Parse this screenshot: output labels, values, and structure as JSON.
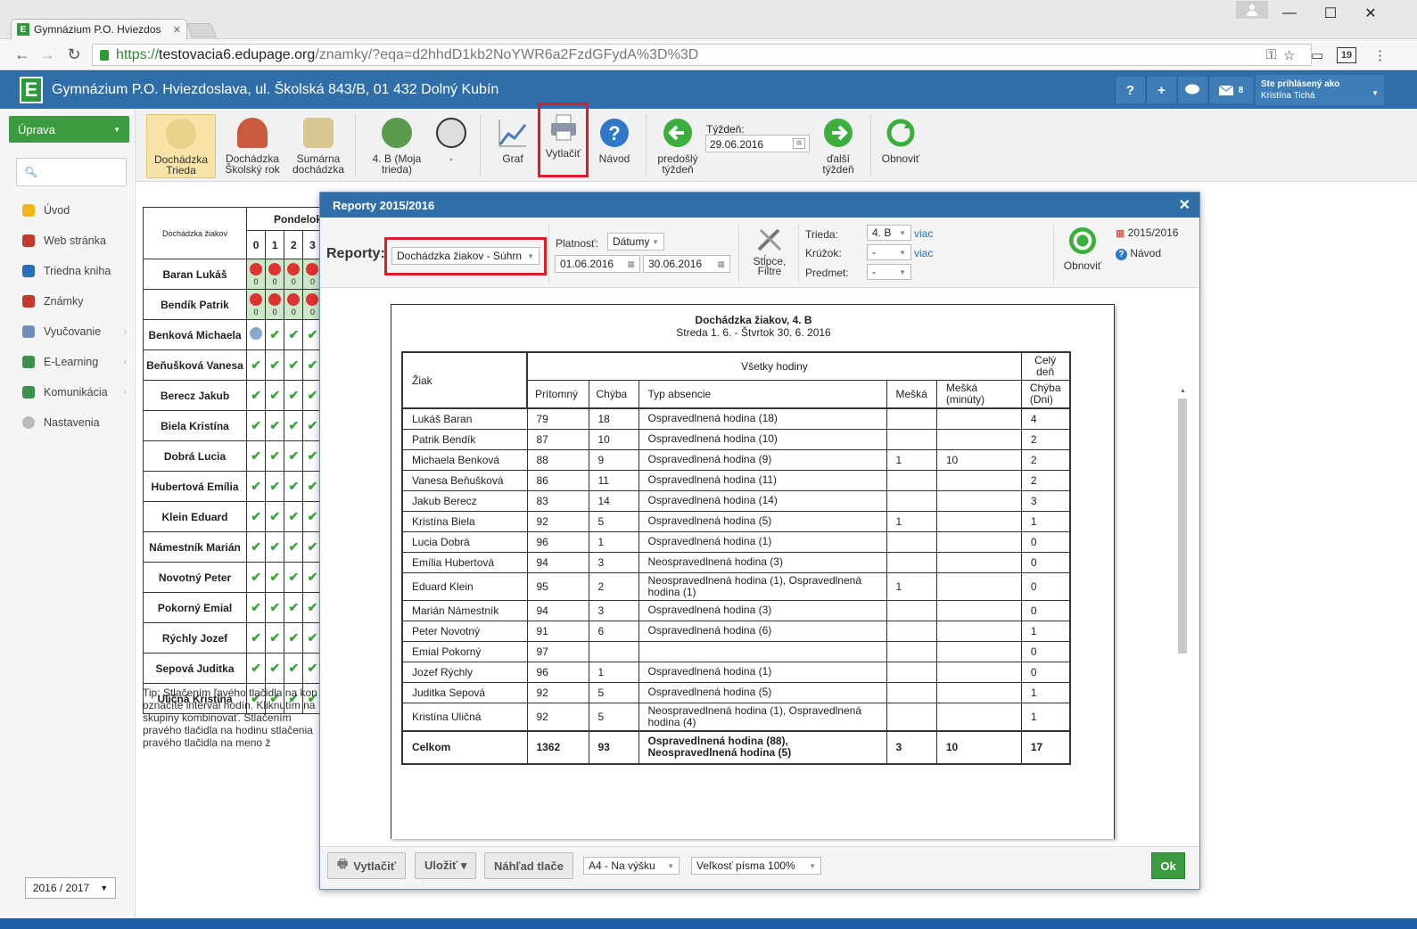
{
  "browser": {
    "tab_title": "Gymnázium P.O. Hviezdos",
    "url_scheme": "https://",
    "url_host": "testovacia6.edupage.org",
    "url_path": "/znamky/?eqa=d2hhdD1kb2NoYWR6a2FzdGFydA%3D%3D",
    "calendar_badge": "19"
  },
  "header": {
    "school_name": "Gymnázium P.O. Hviezdoslava, ul. Školská 843/B, 01 432 Dolný Kubín",
    "help": "?",
    "add": "+",
    "messages_count": "8",
    "logged_label": "Ste prihlásený ako",
    "user_name": "Kristína Tichá"
  },
  "sidebar": {
    "edit_button": "Úprava",
    "items": [
      "Úvod",
      "Web stránka",
      "Triedna kniha",
      "Známky",
      "Vyučovanie",
      "E-Learning",
      "Komunikácia",
      "Nastavenia"
    ],
    "year": "2016 / 2017"
  },
  "toolbar": {
    "btn1": "Dochádzka Trieda",
    "btn2": "Dochádzka Školský rok",
    "btn3": "Sumárna dochádzka",
    "btn4": "4. B (Moja trieda)",
    "btn5": "-",
    "btn6": "Graf",
    "btn7": "Vytlačiť",
    "btn8": "Návod",
    "btn9": "predošlý týždeň",
    "week_label": "Týždeň:",
    "week_value": "29.06.2016",
    "btn10": "ďalší týždeň",
    "btn11": "Obnoviť"
  },
  "attendance": {
    "header": "Dochádzka žiakov",
    "day": "Pondelok",
    "hours": [
      "0",
      "1",
      "2",
      "3"
    ],
    "zero": "0",
    "students": [
      "Baran Lukáš",
      "Bendík Patrik",
      "Benková Michaela",
      "Beňušková Vanesa",
      "Berecz Jakub",
      "Biela Kristína",
      "Dobrá Lucia",
      "Hubertová Emília",
      "Klein Eduard",
      "Námestník Marián",
      "Novotný Peter",
      "Pokorný Emial",
      "Rýchly Jozef",
      "Sepová Juditka",
      "Uličná Kristína"
    ],
    "tip": "Tip: Stlačením ľavého tlačidla na kon označíte interval hodín. Kliknutím na skupiny kombinovať. Stlačením pravého tlačidla na hodinu stlačenia pravého tlačidla na meno ž"
  },
  "dialog": {
    "title": "Reporty 2015/2016",
    "reports_label": "Reporty:",
    "report_value": "Dochádzka žiakov - Súhrn",
    "validity_label": "Platnosť:",
    "validity_value": "Dátumy",
    "date_from": "01.06.2016",
    "date_to": "30.06.2016",
    "columns_label": "Stĺpce, Filtre",
    "class_label": "Trieda:",
    "class_value": "4. B",
    "more": "viac",
    "circle_label": "Krúžok:",
    "circle_value": "-",
    "subject_label": "Predmet:",
    "subject_value": "-",
    "refresh": "Obnoviť",
    "year_link": "2015/2016",
    "help_link": "Návod",
    "footer": {
      "print": "Vytlačiť",
      "save": "Uložiť ▾",
      "preview": "Náhľad tlače",
      "page_format": "A4 - Na výšku",
      "font_size": "Veľkosť písma 100%",
      "ok": "Ok"
    }
  },
  "report": {
    "title": "Dochádzka žiakov, 4. B",
    "subtitle": "Streda 1. 6. - Štvrtok 30. 6. 2016",
    "col_student": "Žiak",
    "col_all": "Všetky hodiny",
    "col_fullday": "Celý deň",
    "col_present": "Prítomný",
    "col_missing": "Chýba",
    "col_type": "Typ absencie",
    "col_late": "Mešká",
    "col_late_min": "Mešká (minúty)",
    "col_missing_days": "Chýba (Dni)",
    "rows": [
      [
        "Lukáš Baran",
        "79",
        "18",
        "Ospravedlnená hodina (18)",
        "",
        "",
        "4"
      ],
      [
        "Patrik Bendík",
        "87",
        "10",
        "Ospravedlnená hodina (10)",
        "",
        "",
        "2"
      ],
      [
        "Michaela Benková",
        "88",
        "9",
        "Ospravedlnená hodina (9)",
        "1",
        "10",
        "2"
      ],
      [
        "Vanesa Beňušková",
        "86",
        "11",
        "Ospravedlnená hodina (11)",
        "",
        "",
        "2"
      ],
      [
        "Jakub Berecz",
        "83",
        "14",
        "Ospravedlnená hodina (14)",
        "",
        "",
        "3"
      ],
      [
        "Kristína Biela",
        "92",
        "5",
        "Ospravedlnená hodina (5)",
        "1",
        "",
        "1"
      ],
      [
        "Lucia Dobrá",
        "96",
        "1",
        "Ospravedlnená hodina (1)",
        "",
        "",
        "0"
      ],
      [
        "Emília Hubertová",
        "94",
        "3",
        "Neospravedlnená hodina (3)",
        "",
        "",
        "0"
      ],
      [
        "Eduard Klein",
        "95",
        "2",
        "Neospravedlnená hodina (1), Ospravedlnená hodina (1)",
        "1",
        "",
        "0"
      ],
      [
        "Marián Námestník",
        "94",
        "3",
        "Ospravedlnená hodina (3)",
        "",
        "",
        "0"
      ],
      [
        "Peter Novotný",
        "91",
        "6",
        "Ospravedlnená hodina (6)",
        "",
        "",
        "1"
      ],
      [
        "Emial Pokorný",
        "97",
        "",
        "",
        "",
        "",
        "0"
      ],
      [
        "Jozef Rýchly",
        "96",
        "1",
        "Ospravedlnená hodina (1)",
        "",
        "",
        "0"
      ],
      [
        "Juditka Sepová",
        "92",
        "5",
        "Ospravedlnená hodina (5)",
        "",
        "",
        "1"
      ],
      [
        "Kristína Uličná",
        "92",
        "5",
        "Neospravedlnená hodina (1), Ospravedlnená hodina (4)",
        "",
        "",
        "1"
      ]
    ],
    "total": [
      "Celkom",
      "1362",
      "93",
      "Ospravedlnená hodina (88), Neospravedlnená hodina (5)",
      "3",
      "10",
      "17"
    ]
  }
}
